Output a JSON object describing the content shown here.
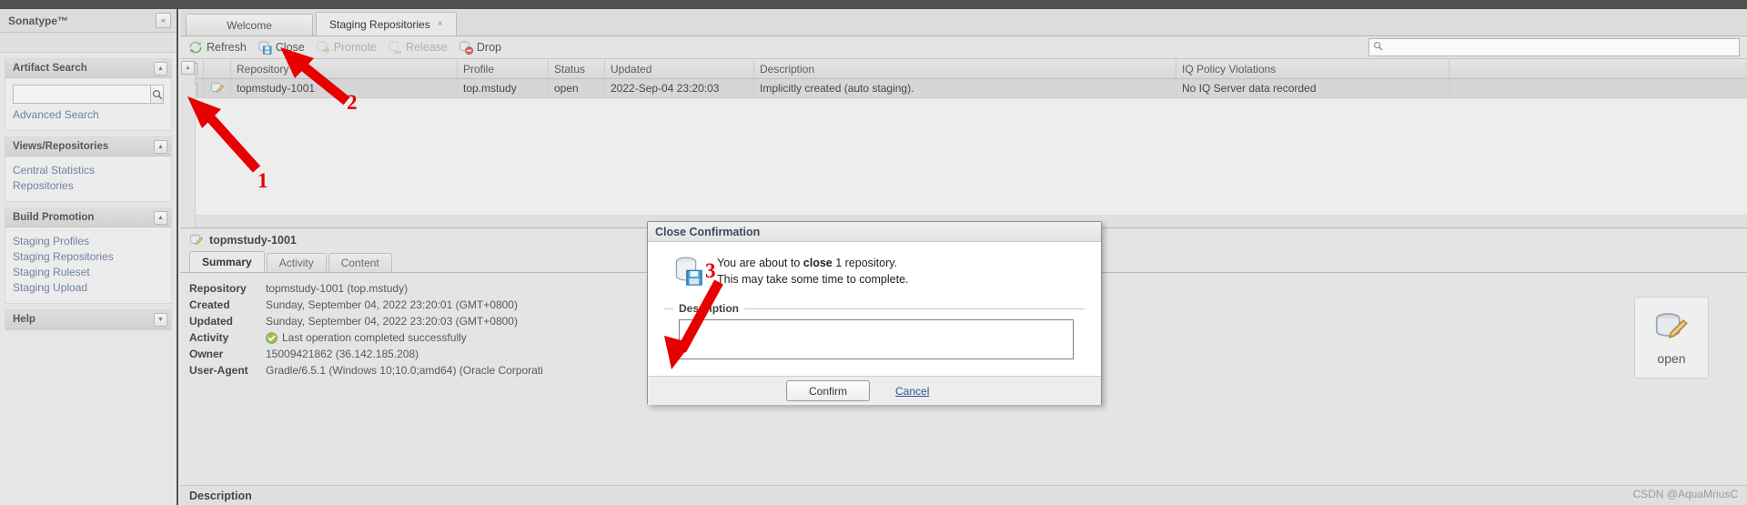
{
  "sidebar": {
    "brand": "Sonatype™",
    "collapse_icon": "«",
    "panels": [
      {
        "title": "Artifact Search",
        "search_placeholder": "",
        "search_value": "",
        "links": [
          "Advanced Search"
        ]
      },
      {
        "title": "Views/Repositories",
        "links": [
          "Central Statistics",
          "Repositories"
        ]
      },
      {
        "title": "Build Promotion",
        "links": [
          "Staging Profiles",
          "Staging Repositories",
          "Staging Ruleset",
          "Staging Upload"
        ]
      },
      {
        "title": "Help",
        "links": []
      }
    ]
  },
  "tabs": [
    {
      "label": "Welcome",
      "active": false,
      "closable": false
    },
    {
      "label": "Staging Repositories",
      "active": true,
      "closable": true,
      "close_icon": "×"
    }
  ],
  "toolbar": {
    "buttons": [
      {
        "label": "Refresh",
        "icon": "refresh-icon",
        "disabled": false
      },
      {
        "label": "Close",
        "icon": "close-icon",
        "disabled": false
      },
      {
        "label": "Promote",
        "icon": "promote-icon",
        "disabled": true
      },
      {
        "label": "Release",
        "icon": "release-icon",
        "disabled": true
      },
      {
        "label": "Drop",
        "icon": "drop-icon",
        "disabled": false
      }
    ],
    "search_placeholder": "",
    "search_value": ""
  },
  "grid": {
    "columns": [
      "",
      "",
      "Repository",
      "Profile",
      "Status",
      "Updated",
      "Description",
      "IQ Policy Violations"
    ],
    "rows": [
      {
        "checked": true,
        "check_glyph": "✓",
        "repository": "topmstudy-1001",
        "profile": "top.mstudy",
        "status": "open",
        "updated": "2022-Sep-04 23:20:03",
        "description": "Implicitly created (auto staging).",
        "iq_policy_violations": "No IQ Server data recorded"
      }
    ]
  },
  "details": {
    "title": "topmstudy-1001",
    "tabs": [
      {
        "label": "Summary",
        "active": true
      },
      {
        "label": "Activity",
        "active": false
      },
      {
        "label": "Content",
        "active": false
      }
    ],
    "fields": [
      {
        "key": "Repository",
        "value": "topmstudy-1001 (top.mstudy)"
      },
      {
        "key": "Created",
        "value": "Sunday, September 04, 2022 23:20:01 (GMT+0800)"
      },
      {
        "key": "Updated",
        "value": "Sunday, September 04, 2022 23:20:03 (GMT+0800)"
      },
      {
        "key": "Activity",
        "value": "Last operation completed successfully",
        "status_icon": "success-check-icon"
      },
      {
        "key": "Owner",
        "value": "15009421862 (36.142.185.208)"
      },
      {
        "key": "User-Agent",
        "value": "Gradle/6.5.1 (Windows 10;10.0;amd64) (Oracle Corporati"
      }
    ],
    "footer_title": "Description"
  },
  "status_card": {
    "label": "open",
    "icon": "repository-open-icon"
  },
  "dialog": {
    "title": "Close Confirmation",
    "icon": "database-save-icon",
    "message_line1_prefix": "You are about to ",
    "message_line1_bold": "close",
    "message_line1_suffix": " 1 repository.",
    "message_line2": "This may take some time to complete.",
    "fieldset_legend": "Description",
    "textarea_value": "",
    "textarea_placeholder": "",
    "confirm_label": "Confirm",
    "cancel_label": "Cancel"
  },
  "annotations": [
    {
      "number": "1"
    },
    {
      "number": "2"
    },
    {
      "number": "3"
    }
  ],
  "watermark": "CSDN @AquaMriusC",
  "colors": {
    "accent_red": "#e60000",
    "link_blue": "#6d7fa3",
    "header_dark": "#4d4d4d"
  }
}
